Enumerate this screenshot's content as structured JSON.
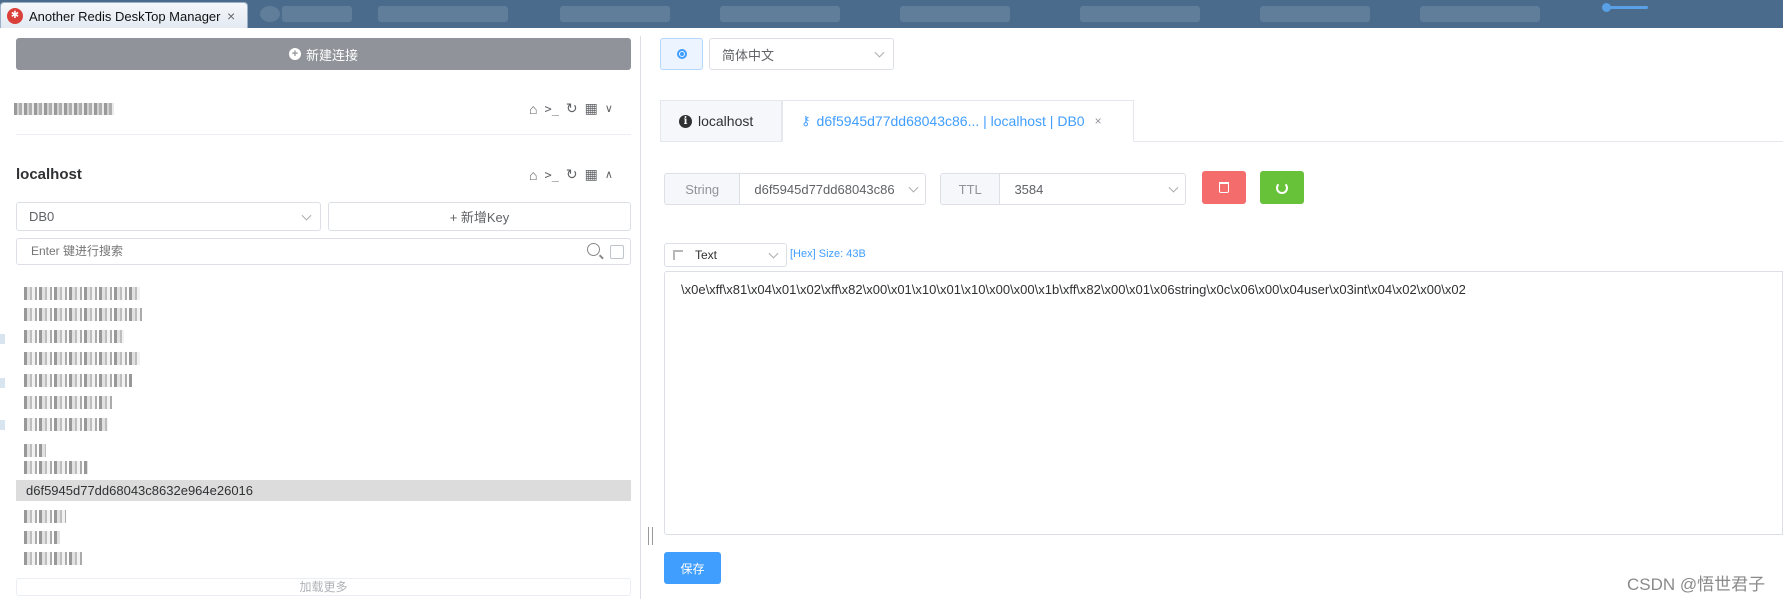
{
  "window": {
    "title": "Another Redis DeskTop Manager",
    "close_glyph": "×"
  },
  "sidebar": {
    "new_connection_label": "新建连接",
    "connections": [
      {
        "name": "",
        "blurred": true
      },
      {
        "name": "localhost",
        "blurred": false
      }
    ],
    "db_select": {
      "value": "DB0"
    },
    "add_key_label": "+ 新增Key",
    "search": {
      "placeholder": "Enter 键进行搜索"
    },
    "selected_key": "d6f5945d77dd68043c8632e964e26016",
    "load_more_label": "加载更多"
  },
  "toolbar": {
    "language_select": {
      "value": "简体中文"
    }
  },
  "tabs": [
    {
      "label": "localhost",
      "icon": "info-icon",
      "active": false
    },
    {
      "label": "d6f5945d77dd68043c86... | localhost | DB0",
      "icon": "key-icon",
      "active": true,
      "close_glyph": "×"
    }
  ],
  "key_detail": {
    "type_label": "String",
    "key_name": "d6f5945d77dd68043c86",
    "ttl_label": "TTL",
    "ttl_value": "3584",
    "danger_color": "#f56c6c",
    "success_color": "#67c23a"
  },
  "viewer": {
    "format_select": {
      "value": "Text"
    },
    "hex_size_label": "[Hex] Size: 43B",
    "value": "\\x0e\\xff\\x81\\x04\\x01\\x02\\xff\\x82\\x00\\x01\\x10\\x01\\x10\\x00\\x00\\x1b\\xff\\x82\\x00\\x01\\x06string\\x0c\\x06\\x00\\x04user\\x03int\\x04\\x02\\x00\\x02",
    "save_label": "保存"
  },
  "watermark": "CSDN @悟世君子",
  "colors": {
    "accent": "#409eff",
    "titlebar": "#4a6b8c"
  }
}
